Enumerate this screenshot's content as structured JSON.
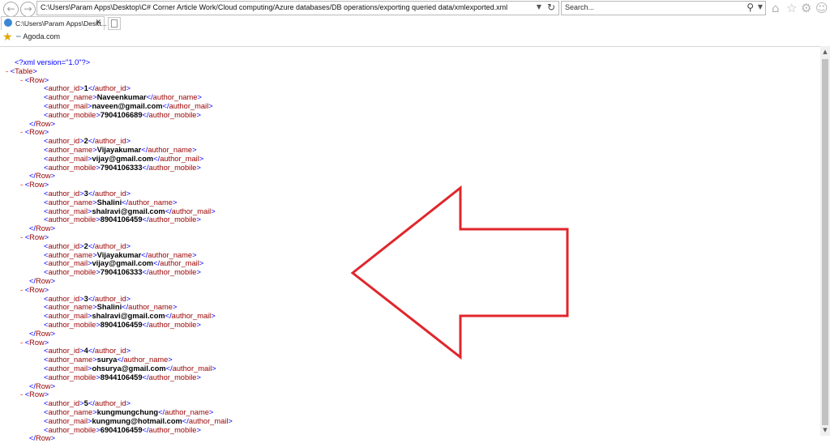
{
  "browser": {
    "address_url": "C:\\Users\\Param Apps\\Desktop\\C# Corner Article Work/Cloud computing/Azure databases/DB operations/exporting queried data/xmlexported.xml",
    "search_placeholder": "Search...",
    "tab_title": "C:\\Users\\Param Apps\\Deskt...",
    "favorites_link": "Agoda.com"
  },
  "xml": {
    "declaration": "<?xml version=\"1.0\"?>",
    "root": "Table",
    "row_tag": "Row",
    "fields": [
      "author_id",
      "author_name",
      "author_mail",
      "author_mobile"
    ],
    "rows": [
      {
        "author_id": "1",
        "author_name": "Naveenkumar",
        "author_mail": "naveen@gmail.com",
        "author_mobile": "7904106689"
      },
      {
        "author_id": "2",
        "author_name": "Vijayakumar",
        "author_mail": "vijay@gmail.com",
        "author_mobile": "7904106333"
      },
      {
        "author_id": "3",
        "author_name": "Shalini",
        "author_mail": "shalravi@gmail.com",
        "author_mobile": "8904106459"
      },
      {
        "author_id": "2",
        "author_name": "Vijayakumar",
        "author_mail": "vijay@gmail.com",
        "author_mobile": "7904106333"
      },
      {
        "author_id": "3",
        "author_name": "Shalini",
        "author_mail": "shalravi@gmail.com",
        "author_mobile": "8904106459"
      },
      {
        "author_id": "4",
        "author_name": "surya",
        "author_mail": "ohsurya@gmail.com",
        "author_mobile": "8944106459"
      },
      {
        "author_id": "5",
        "author_name": "kungmungchung",
        "author_mail": "kungmung@hotmail.com",
        "author_mobile": "6904106459"
      }
    ]
  },
  "colors": {
    "xml_declaration": "#0000ff",
    "xml_tag": "#990000",
    "collapse_marker": "#ff0000",
    "annotation_arrow": "#e0262b"
  }
}
